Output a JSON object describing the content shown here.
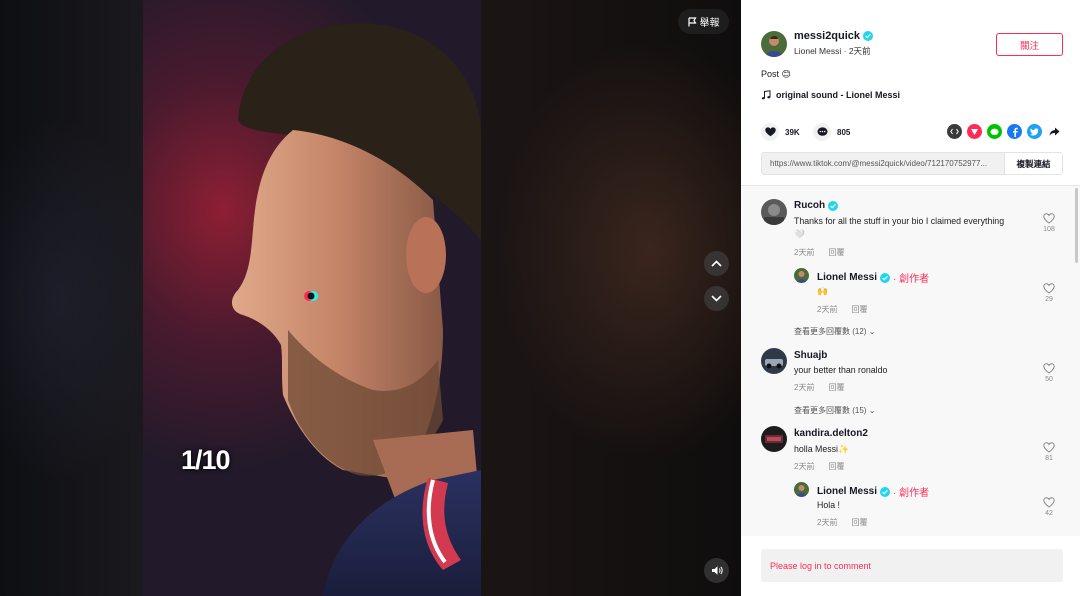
{
  "video": {
    "slide_counter": "1/10",
    "report_label": "舉報"
  },
  "author": {
    "username": "messi2quick",
    "display_name": "Lionel Messi",
    "time": "2天前",
    "follow_label": "關注"
  },
  "caption": "Post 😊",
  "music": "original sound - Lionel Messi",
  "stats": {
    "likes": "39K",
    "comments": "805"
  },
  "share_link": {
    "url": "https://www.tiktok.com/@messi2quick/video/712170752977...",
    "copy_label": "複製連結"
  },
  "comments": [
    {
      "user": "Rucoh",
      "text": "Thanks for all the stuff in your bio I claimed everything",
      "text2": "🤍",
      "time": "2天前",
      "reply_label": "回覆",
      "likes": "108"
    },
    {
      "user": "Lionel Messi",
      "badge": "· 創作者",
      "text": "🙌",
      "time": "2天前",
      "reply_label": "回覆",
      "likes": "29"
    },
    {
      "more_replies": "查看更多回覆數 (12)"
    },
    {
      "user": "Shuajb",
      "text": "your better than ronaldo",
      "time": "2天前",
      "reply_label": "回覆",
      "likes": "50"
    },
    {
      "more_replies": "查看更多回覆數 (15)"
    },
    {
      "user": "kandira.delton2",
      "text": "holla Messi✨",
      "time": "2天前",
      "reply_label": "回覆",
      "likes": "81"
    },
    {
      "user": "Lionel Messi",
      "badge": "· 創作者",
      "text": "Hola !",
      "time": "2天前",
      "reply_label": "回覆",
      "likes": "42"
    }
  ],
  "login_prompt": "Please log in to comment",
  "colors": {
    "accent": "#fe2c55",
    "verified": "#20d5ec"
  }
}
